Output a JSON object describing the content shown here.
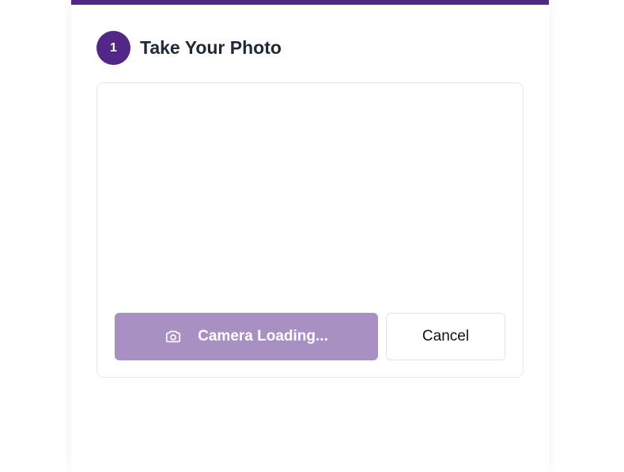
{
  "step": {
    "number": "1",
    "title": "Take Your Photo"
  },
  "camera": {
    "capture_label": "Camera Loading...",
    "capture_icon": "camera-icon",
    "cancel_label": "Cancel"
  },
  "colors": {
    "brand": "#522785",
    "capture_disabled": "#a890c2"
  }
}
